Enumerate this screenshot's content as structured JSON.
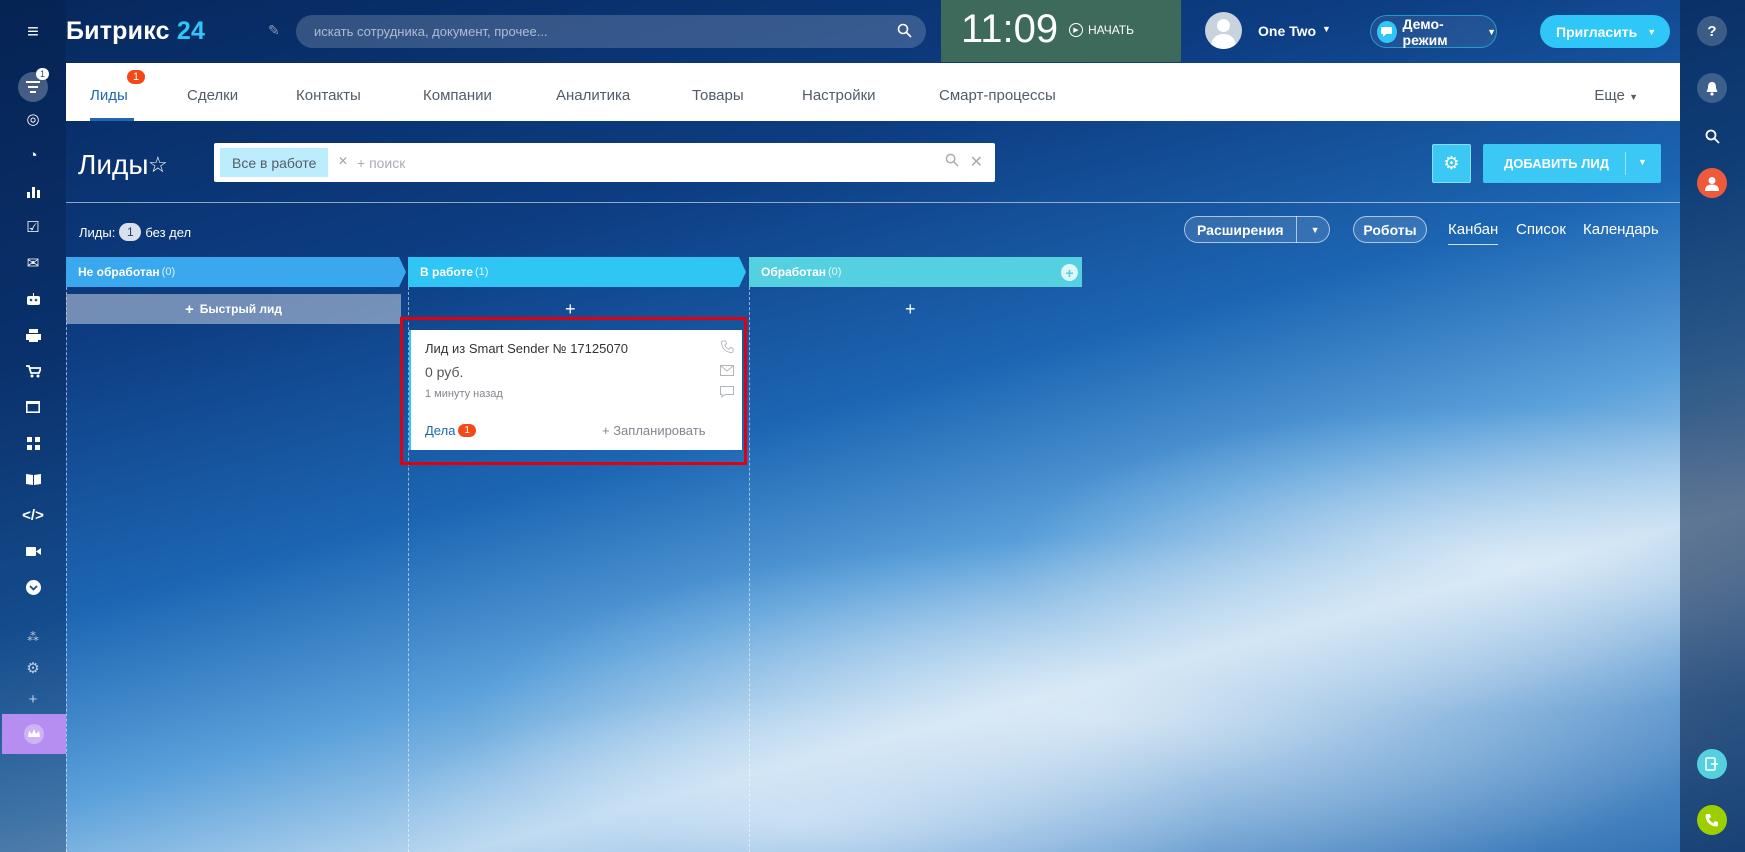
{
  "header": {
    "logo_text": "Битрикс",
    "logo_suffix": "24",
    "search_placeholder": "искать сотрудника, документ, прочее...",
    "clock": "11:09",
    "start_label": "НАЧАТЬ",
    "user_name": "One Two",
    "demo_label": "Демо-режим",
    "invite_label": "Пригласить"
  },
  "left_sidebar": {
    "badge": "1",
    "icons": [
      "hamburger-icon",
      "filter-icon",
      "target-icon",
      "clock-icon",
      "bar-chart-icon",
      "tasks-icon",
      "mail-icon",
      "robot-icon",
      "printer-icon",
      "cart-icon",
      "window-icon",
      "grid-icon",
      "book-icon",
      "code-icon",
      "video-icon",
      "chevron-down-icon",
      "sitemap-icon",
      "gear-icon",
      "plus-icon",
      "crown-icon"
    ]
  },
  "right_sidebar": {
    "icons": [
      "help-icon",
      "bell-icon",
      "search-icon",
      "user-icon",
      "open-line-icon",
      "phone-icon"
    ]
  },
  "tabs": {
    "items": [
      "Лиды",
      "Сделки",
      "Контакты",
      "Компании",
      "Аналитика",
      "Товары",
      "Настройки",
      "Смарт-процессы"
    ],
    "active_badge": "1",
    "more": "Еще"
  },
  "toolbar": {
    "title": "Лиды",
    "filter_chip": "Все в работе",
    "filter_search": "+ поиск",
    "add_button": "ДОБАВИТЬ ЛИД"
  },
  "summary": {
    "prefix": "Лиды:",
    "count": "1",
    "suffix": "без дел"
  },
  "view_switcher": {
    "extensions": "Расширения",
    "robots": "Роботы",
    "kanban": "Канбан",
    "list": "Список",
    "calendar": "Календарь"
  },
  "kanban": {
    "columns": [
      {
        "title": "Не обработан",
        "count": "(0)",
        "color": "#39a8ef"
      },
      {
        "title": "В работе",
        "count": "(1)",
        "color": "#2fc6f6"
      },
      {
        "title": "Обработан",
        "count": "(0)",
        "color": "#55d0e0"
      }
    ],
    "quick_lead": "Быстрый лид",
    "add_symbol": "+"
  },
  "card": {
    "title": "Лид из Smart Sender № 17125070",
    "price": "0 руб.",
    "time": "1 минуту назад",
    "deals_label": "Дела",
    "deals_count": "1",
    "plan_label": "+ Запланировать"
  }
}
